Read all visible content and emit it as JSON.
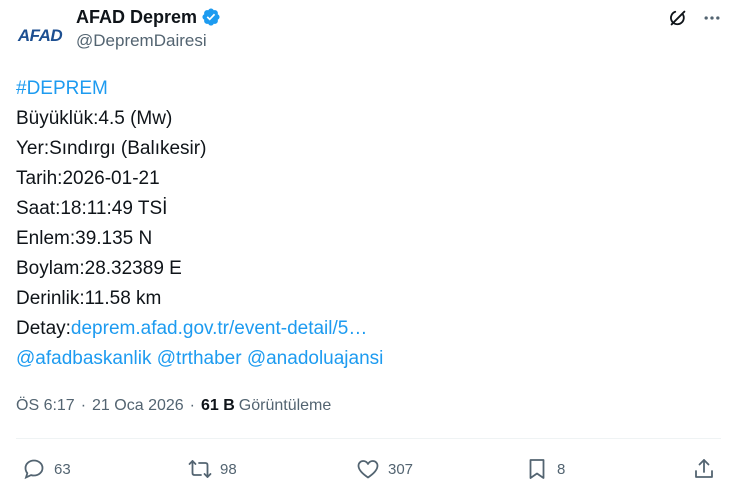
{
  "author": {
    "avatar_text": "AFAD",
    "display_name": "AFAD Deprem",
    "handle": "@DepremDairesi"
  },
  "post": {
    "hashtag": "#DEPREM",
    "lines": {
      "magnitude": "Büyüklük:4.5 (Mw)",
      "location": "Yer:Sındırgı (Balıkesir)",
      "date": "Tarih:2026-01-21",
      "time": "Saat:18:11:49 TSİ",
      "latitude": "Enlem:39.135 N",
      "longitude": "Boylam:28.32389 E",
      "depth": "Derinlik:11.58 km",
      "detail_label": "Detay:",
      "detail_link": "deprem.afad.gov.tr/event-detail/5…"
    },
    "mentions": [
      "@afadbaskanlik",
      "@trthaber",
      "@anadoluajansi"
    ]
  },
  "meta": {
    "time": "ÖS 6:17",
    "separator": "·",
    "date": "21 Oca 2026",
    "views_count": "61 B",
    "views_label": "Görüntüleme"
  },
  "actions": {
    "replies": "63",
    "reposts": "98",
    "likes": "307",
    "bookmarks": "8"
  },
  "icons": {
    "verified": "verified-badge-icon",
    "grok": "grok-icon",
    "more": "more-dots-icon",
    "reply": "reply-icon",
    "repost": "repost-icon",
    "like": "heart-icon",
    "bookmark": "bookmark-icon",
    "share": "share-icon"
  },
  "colors": {
    "link": "#1d9bf0",
    "text": "#0f1419",
    "secondary": "#536471",
    "brand": "#1d4f91"
  }
}
